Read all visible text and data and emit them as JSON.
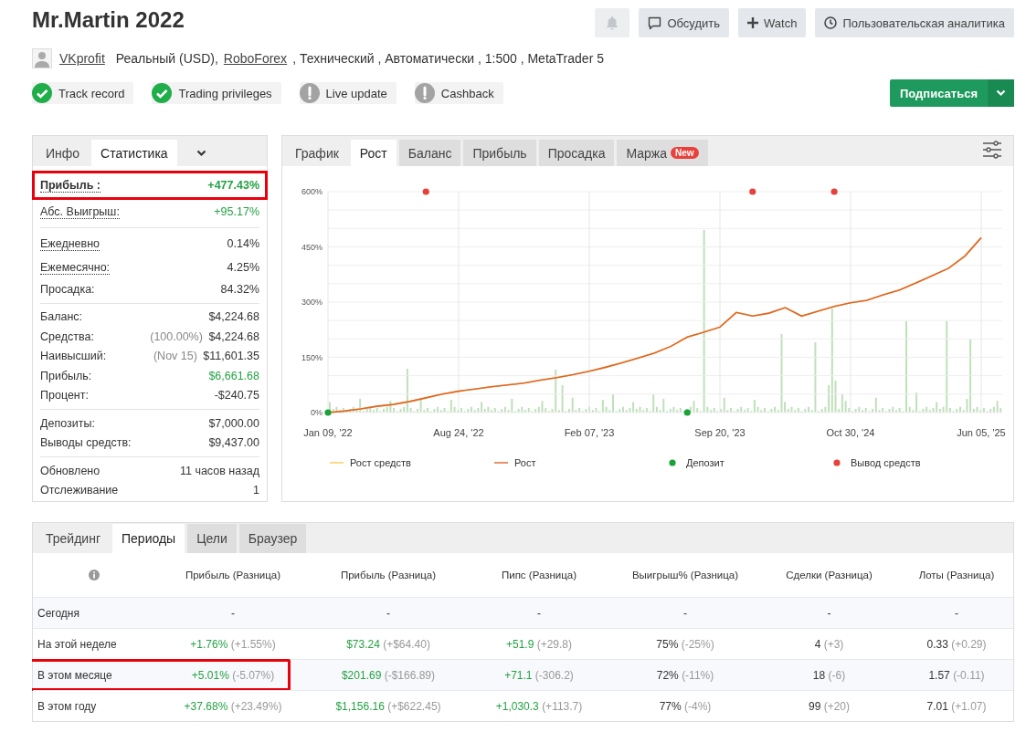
{
  "title": "Mr.Martin 2022",
  "header_buttons": [
    {
      "kind": "notify",
      "disabled": true
    },
    {
      "kind": "discuss",
      "label": "Обсудить",
      "disabled": false
    },
    {
      "kind": "watch",
      "label": "Watch",
      "disabled": false
    },
    {
      "kind": "analytics",
      "label": "Пользовательская аналитика",
      "disabled": false
    }
  ],
  "author": "VKprofit",
  "details": [
    {
      "text": "Реальный (USD),",
      "link": false
    },
    {
      "text": "RoboForex",
      "link": true
    },
    {
      "text": ", Технический , Автоматически , 1:500 , MetaTrader 5",
      "link": false
    }
  ],
  "badges": [
    {
      "label": "Track record",
      "verified": true
    },
    {
      "label": "Trading privileges",
      "verified": true
    },
    {
      "label": "Live update",
      "verified": false
    },
    {
      "label": "Cashback",
      "verified": false
    }
  ],
  "subscribe_button": "Подписаться",
  "stats_tabs": [
    {
      "label": "Инфо",
      "selected": false
    },
    {
      "label": "Статистика",
      "selected": true
    }
  ],
  "stats_groups": [
    [
      {
        "label": "Прибыль :",
        "value": "+477.43%",
        "positive": true,
        "hint": true,
        "highlighted": true
      },
      {
        "label": "Абс. Выигрыш:",
        "value": "+95.17%",
        "positive": true,
        "hint": true,
        "highlighted": false
      }
    ],
    [
      {
        "label": "Ежедневно",
        "value": "0.14%",
        "positive": false,
        "hint": true,
        "highlighted": false
      },
      {
        "label": "Ежемесячно:",
        "value": "4.25%",
        "positive": false,
        "hint": true,
        "highlighted": false
      },
      {
        "label": "Просадка:",
        "value": "84.32%",
        "positive": false,
        "hint": false,
        "highlighted": false
      }
    ],
    [
      {
        "label": "Баланс:",
        "value": "$4,224.68",
        "positive": false,
        "hint": false,
        "highlighted": false
      },
      {
        "label": "Средства:",
        "note": "(100.00%)",
        "value": "$4,224.68",
        "positive": false,
        "hint": false,
        "highlighted": false
      },
      {
        "label": "Наивысший:",
        "note": "(Nov 15)",
        "value": "$11,601.35",
        "positive": false,
        "hint": false,
        "highlighted": false
      },
      {
        "label": "Прибыль:",
        "value": "$6,661.68",
        "positive": true,
        "hint": false,
        "highlighted": false
      },
      {
        "label": "Процент:",
        "value": "-$240.75",
        "positive": false,
        "hint": false,
        "highlighted": false
      }
    ],
    [
      {
        "label": "Депозиты:",
        "value": "$7,000.00",
        "positive": false,
        "hint": false,
        "highlighted": false
      },
      {
        "label": "Выводы средств:",
        "value": "$9,437.00",
        "positive": false,
        "hint": false,
        "highlighted": false
      }
    ],
    [
      {
        "label": "Обновлено",
        "value": "11 часов назад",
        "positive": false,
        "hint": false,
        "highlighted": false
      },
      {
        "label": "Отслеживание",
        "value": "1",
        "positive": false,
        "hint": false,
        "highlighted": false
      }
    ]
  ],
  "chart_tabs": [
    {
      "label": "График",
      "selected": false
    },
    {
      "label": "Рост",
      "selected": true
    },
    {
      "label": "Баланс",
      "selected": false
    },
    {
      "label": "Прибыль",
      "selected": false
    },
    {
      "label": "Просадка",
      "selected": false
    },
    {
      "label": "Маржа",
      "badge": "New",
      "selected": false
    }
  ],
  "chart": {
    "chart_data": {
      "type": "line",
      "categories": [
        "Jan 09, '22",
        null,
        null,
        null,
        null,
        null,
        null,
        null,
        "Aug 24, '22",
        null,
        null,
        null,
        null,
        null,
        null,
        null,
        "Feb 07, '23",
        null,
        null,
        null,
        null,
        null,
        null,
        null,
        "Sep 20, '23",
        null,
        null,
        null,
        null,
        null,
        null,
        null,
        "Oct 30, '24",
        null,
        null,
        null,
        null,
        null,
        null,
        null,
        "Jun 05, '25"
      ],
      "series": [
        {
          "name": "Рост средств",
          "type": "line",
          "color": "#f5cd5a",
          "values": [
            0,
            4,
            10,
            17,
            22,
            30,
            40,
            50,
            58,
            64,
            70,
            75,
            80,
            88,
            95,
            103,
            112,
            123,
            135,
            148,
            162,
            180,
            205,
            218,
            232,
            272,
            262,
            270,
            285,
            262,
            275,
            288,
            298,
            305,
            320,
            333,
            352,
            372,
            392,
            425,
            475
          ]
        },
        {
          "name": "Рост",
          "type": "line",
          "color": "#e0642a",
          "values": [
            0,
            4,
            10,
            17,
            22,
            30,
            40,
            50,
            58,
            64,
            70,
            75,
            80,
            88,
            95,
            103,
            112,
            123,
            135,
            148,
            162,
            180,
            205,
            218,
            232,
            272,
            262,
            270,
            285,
            262,
            275,
            288,
            298,
            305,
            320,
            333,
            352,
            372,
            392,
            425,
            475
          ]
        },
        {
          "name": "Депозит",
          "type": "scatter",
          "color": "#1aa13a",
          "values": [
            0,
            null,
            null,
            null,
            null,
            null,
            null,
            null,
            null,
            null,
            null,
            null,
            null,
            null,
            null,
            null,
            null,
            null,
            null,
            null,
            null,
            null,
            0,
            null,
            null,
            null,
            null,
            null,
            null,
            null,
            null,
            null,
            null,
            null,
            null,
            null,
            null,
            null,
            null,
            null,
            null
          ]
        },
        {
          "name": "Вывод средств",
          "type": "scatter",
          "color": "#e8413c",
          "values": [
            null,
            null,
            null,
            null,
            null,
            null,
            600,
            null,
            null,
            null,
            null,
            null,
            null,
            null,
            null,
            null,
            null,
            null,
            null,
            null,
            null,
            null,
            null,
            null,
            null,
            null,
            600,
            null,
            null,
            null,
            null,
            600,
            null,
            null,
            null,
            null,
            null,
            null,
            null,
            null,
            null
          ]
        }
      ],
      "ylim": [
        0,
        600
      ],
      "grid": true,
      "legend": "bottom",
      "yticks": [
        {
          "value": 0,
          "label": "0%"
        },
        {
          "value": 150,
          "label": "150%"
        },
        {
          "value": 300,
          "label": "300%"
        },
        {
          "value": 450,
          "label": "450%"
        },
        {
          "value": 600,
          "label": "600%"
        }
      ]
    }
  },
  "table_tabs": [
    {
      "label": "Трейдинг",
      "selected": false
    },
    {
      "label": "Периоды",
      "selected": true
    },
    {
      "label": "Цели",
      "selected": false
    },
    {
      "label": "Браузер",
      "selected": false
    }
  ],
  "table": {
    "columns": [
      "Прибыль (Разница)",
      "Прибыль (Разница)",
      "Пипс (Разница)",
      "Выигрыш% (Разница)",
      "Сделки (Разница)",
      "Лоты (Разница)"
    ],
    "rows": [
      {
        "label": "Сегодня",
        "highlighted": false,
        "cells": [
          {
            "value": "-",
            "positive": false
          },
          {
            "value": "-",
            "positive": false
          },
          {
            "value": "-",
            "positive": false
          },
          {
            "value": "-",
            "positive": false
          },
          {
            "value": "-",
            "positive": false
          },
          {
            "value": "-",
            "positive": false
          }
        ]
      },
      {
        "label": "На этой неделе",
        "highlighted": false,
        "cells": [
          {
            "value": "+1.76%",
            "diff": "(+1.55%)",
            "positive": true
          },
          {
            "value": "$73.24",
            "diff": "(+$64.40)",
            "positive": true
          },
          {
            "value": "+51.9",
            "diff": "(+29.8)",
            "positive": true
          },
          {
            "value": "75%",
            "diff": "(-25%)",
            "positive": false
          },
          {
            "value": "4",
            "diff": "(+3)",
            "positive": false
          },
          {
            "value": "0.33",
            "diff": "(+0.29)",
            "positive": false
          }
        ]
      },
      {
        "label": "В этом месяце",
        "highlighted": true,
        "cells": [
          {
            "value": "+5.01%",
            "diff": "(-5.07%)",
            "positive": true
          },
          {
            "value": "$201.69",
            "diff": "(-$166.89)",
            "positive": true
          },
          {
            "value": "+71.1",
            "diff": "(-306.2)",
            "positive": true
          },
          {
            "value": "72%",
            "diff": "(-11%)",
            "positive": false
          },
          {
            "value": "18",
            "diff": "(-6)",
            "positive": false
          },
          {
            "value": "1.57",
            "diff": "(-0.11)",
            "positive": false
          }
        ]
      },
      {
        "label": "В этом году",
        "highlighted": false,
        "cells": [
          {
            "value": "+37.68%",
            "diff": "(+23.49%)",
            "positive": true
          },
          {
            "value": "$1,156.16",
            "diff": "(+$622.45)",
            "positive": true
          },
          {
            "value": "+1,030.3",
            "diff": "(+113.7)",
            "positive": true
          },
          {
            "value": "77%",
            "diff": "(-4%)",
            "positive": false
          },
          {
            "value": "99",
            "diff": "(+20)",
            "positive": false
          },
          {
            "value": "7.01",
            "diff": "(+1.07)",
            "positive": false
          }
        ]
      }
    ]
  }
}
